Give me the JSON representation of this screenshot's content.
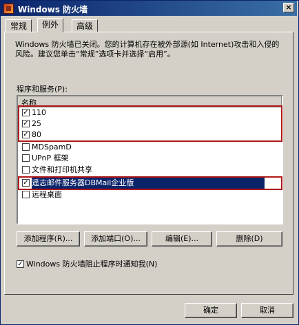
{
  "window": {
    "title": "Windows 防火墙",
    "close_label": "×"
  },
  "tabs": [
    {
      "label": "常规"
    },
    {
      "label": "例外"
    },
    {
      "label": "高级"
    }
  ],
  "description": "Windows 防火墙已关闭。您的计算机存在被外部源(如 Internet)攻击和入侵的风险。建议您单击“常规”选项卡并选择“启用”。",
  "programs_label": "程序和服务(P):",
  "list": {
    "column_header": "名称",
    "items": [
      {
        "label": "110",
        "checked": true
      },
      {
        "label": "25",
        "checked": true
      },
      {
        "label": "80",
        "checked": true
      },
      {
        "label": "MDSpamD",
        "checked": false
      },
      {
        "label": "UPnP 框架",
        "checked": false
      },
      {
        "label": "文件和打印机共享",
        "checked": false
      },
      {
        "label": "遥志邮件服务器DBMail企业版",
        "checked": true,
        "selected": true
      },
      {
        "label": "远程桌面",
        "checked": false
      }
    ]
  },
  "buttons": {
    "add_program": "添加程序(R)...",
    "add_port": "添加端口(O)...",
    "edit": "编辑(E)...",
    "delete": "删除(D)"
  },
  "notify": {
    "label": "Windows 防火墙阻止程序时通知我(N)",
    "checked": true
  },
  "footer": {
    "ok": "确定",
    "cancel": "取消"
  },
  "colors": {
    "highlight_box": "#b01818",
    "selection": "#0a246a",
    "titlebar": "#0a246a"
  }
}
